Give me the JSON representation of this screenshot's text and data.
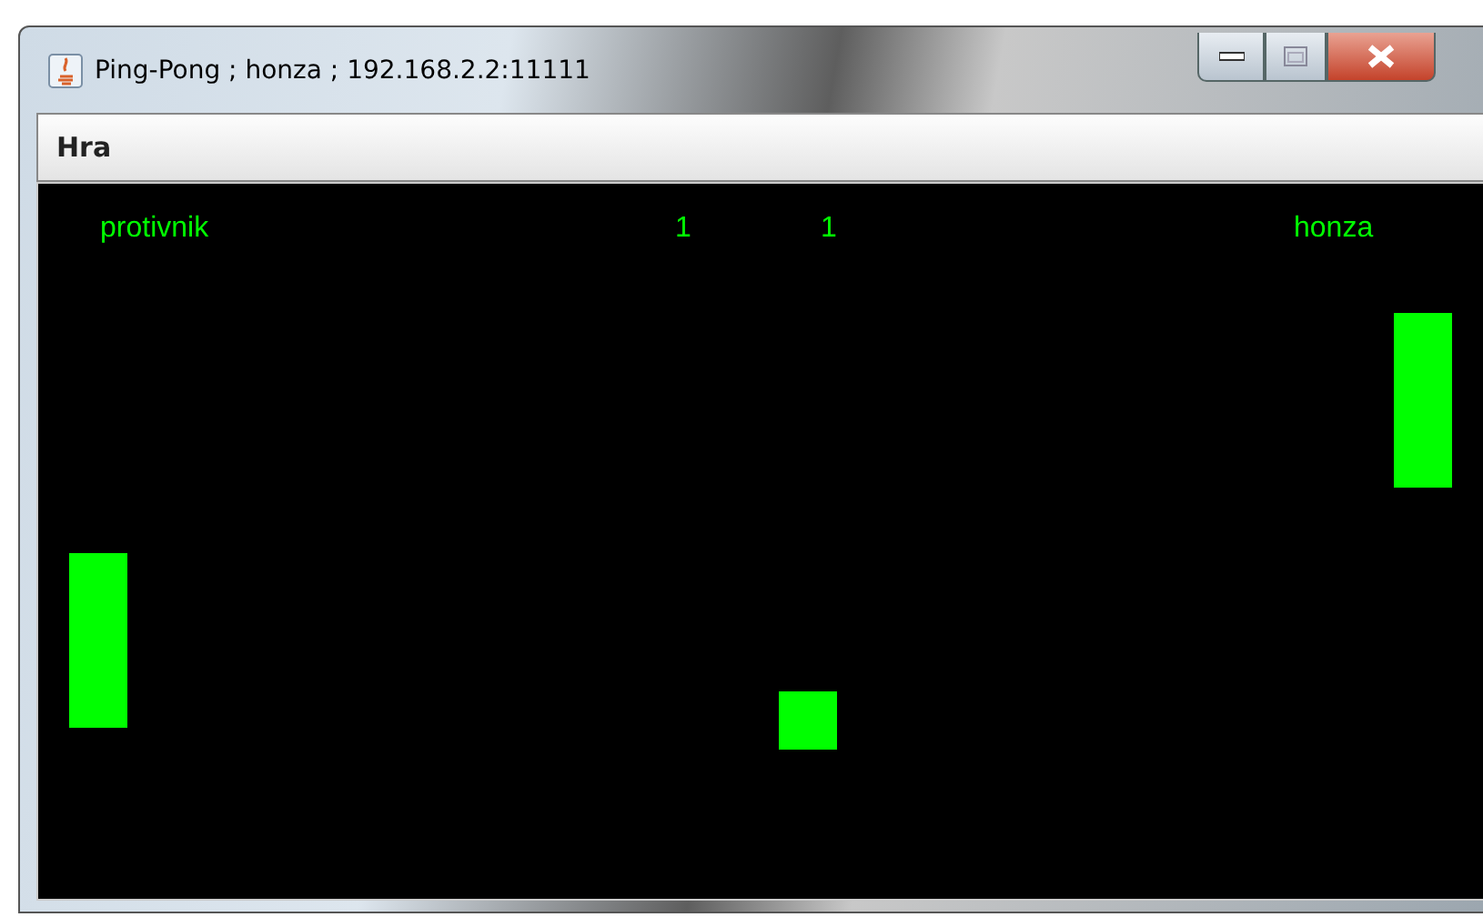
{
  "window": {
    "title": "Ping-Pong ; honza ; 192.168.2.2:11111"
  },
  "menu": [
    "Hra"
  ],
  "game": {
    "players": [
      "protivnik",
      "honza"
    ],
    "scores": [
      "1",
      "1"
    ]
  }
}
